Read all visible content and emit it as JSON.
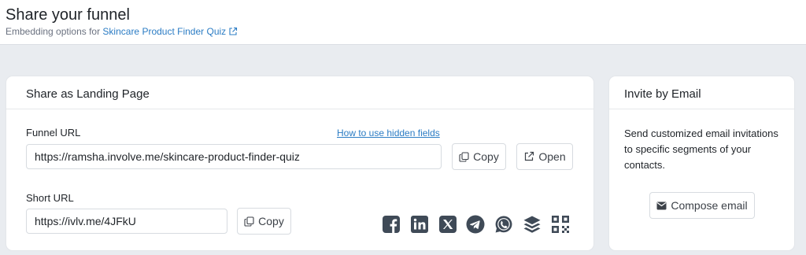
{
  "header": {
    "title": "Share your funnel",
    "subtitle_prefix": "Embedding options for",
    "funnel_name": "Skincare Product Finder Quiz"
  },
  "landing": {
    "title": "Share as Landing Page",
    "funnel_url_label": "Funnel URL",
    "hidden_fields_link": "How to use hidden fields",
    "funnel_url_value": "https://ramsha.involve.me/skincare-product-finder-quiz",
    "copy_label": "Copy",
    "open_label": "Open",
    "short_url_label": "Short URL",
    "short_url_value": "https://ivlv.me/4JFkU",
    "short_copy_label": "Copy",
    "share_icons": [
      "facebook-icon",
      "linkedin-icon",
      "x-icon",
      "telegram-icon",
      "whatsapp-icon",
      "buffer-icon",
      "qr-code-icon"
    ]
  },
  "email": {
    "title": "Invite by Email",
    "description": "Send customized email invitations to specific segments of your contacts.",
    "compose_label": "Compose email"
  }
}
